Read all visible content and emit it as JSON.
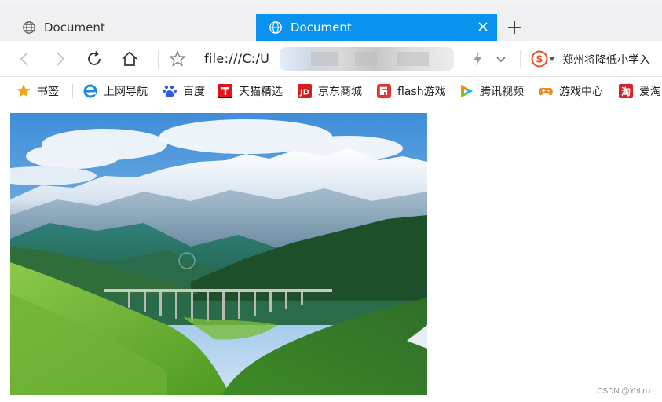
{
  "tabs": [
    {
      "title": "Document",
      "active": false
    },
    {
      "title": "Document",
      "active": true
    }
  ],
  "address_bar": {
    "url": "file:///C:/U"
  },
  "search_box": {
    "text": "郑州将降低小学入"
  },
  "bookmarks": [
    {
      "label": "书签",
      "icon": "star-icon"
    },
    {
      "label": "上网导航",
      "icon": "ie-icon"
    },
    {
      "label": "百度",
      "icon": "baidu-icon"
    },
    {
      "label": "天猫精选",
      "icon": "tmall-icon"
    },
    {
      "label": "京东商城",
      "icon": "jd-icon"
    },
    {
      "label": "flash游戏",
      "icon": "flash-icon"
    },
    {
      "label": "腾讯视频",
      "icon": "tencent-video-icon"
    },
    {
      "label": "游戏中心",
      "icon": "game-center-icon"
    },
    {
      "label": "爱淘",
      "icon": "taobao-icon"
    }
  ],
  "image": {
    "description_icon": "mountain-landscape-photo"
  },
  "credit": "CSDN @YoLo♪",
  "colors": {
    "active_tab": "#0a93ee",
    "tab_strip": "#f0f0f2"
  }
}
